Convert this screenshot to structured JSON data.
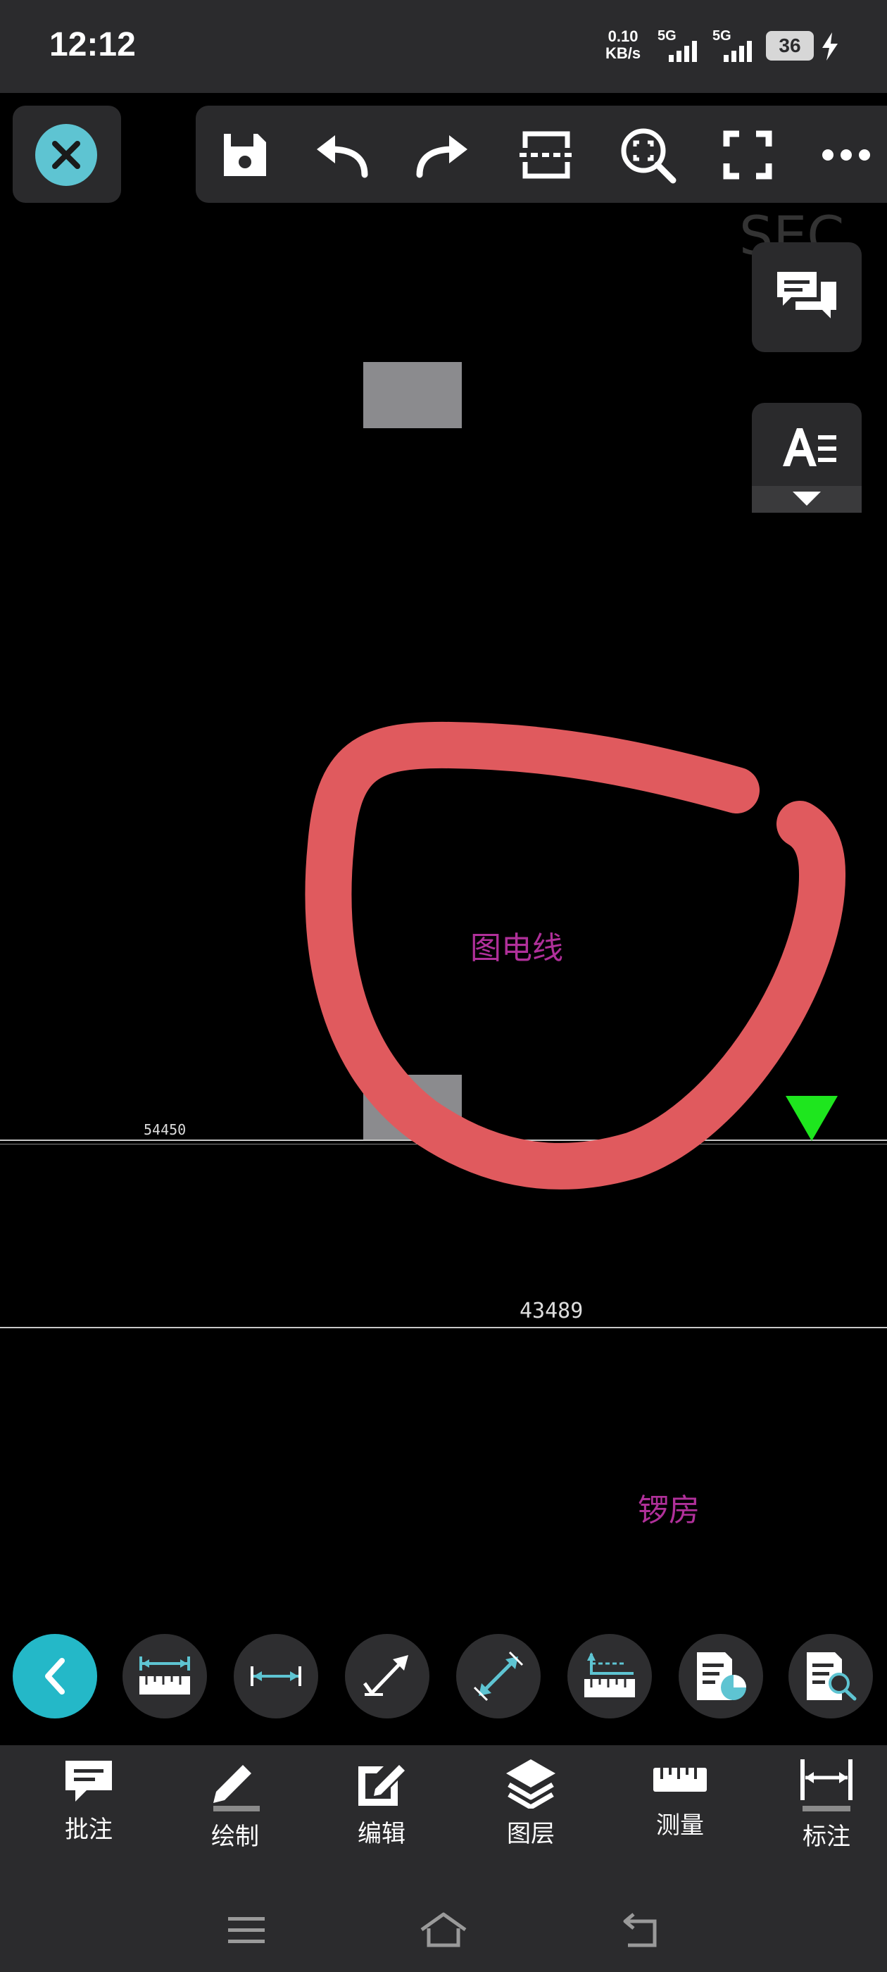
{
  "status_bar": {
    "time": "12:12",
    "net_speed_value": "0.10",
    "net_speed_unit": "KB/s",
    "signal1_label": "5G",
    "signal2_label": "5G",
    "battery": "36"
  },
  "toolbar": {
    "items": [
      "save-icon",
      "undo-icon",
      "redo-icon",
      "split-view-icon",
      "zoom-fit-icon",
      "fullscreen-icon",
      "more-icon"
    ]
  },
  "canvas": {
    "partial_text_top": "SEC",
    "label_wire": "图电线",
    "label_boiler": "锣房",
    "dim_left": "54450",
    "dim_center": "43489"
  },
  "measure_tools": [
    "back-icon",
    "ruler-linear-icon",
    "distance-icon",
    "leader-arrow-icon",
    "aligned-dimension-icon",
    "coordinate-ruler-icon",
    "area-report-icon",
    "search-document-icon"
  ],
  "tabs": [
    {
      "label": "批注",
      "icon": "comment-icon"
    },
    {
      "label": "绘制",
      "icon": "pencil-icon"
    },
    {
      "label": "编辑",
      "icon": "edit-icon"
    },
    {
      "label": "图层",
      "icon": "layers-icon"
    },
    {
      "label": "测量",
      "icon": "ruler-icon"
    },
    {
      "label": "标注",
      "icon": "dimension-icon"
    }
  ],
  "colors": {
    "accent": "#24b8c8",
    "annotation_stroke": "#e05a5e",
    "cad_text": "#b0309a",
    "marker": "#1ee61e"
  }
}
